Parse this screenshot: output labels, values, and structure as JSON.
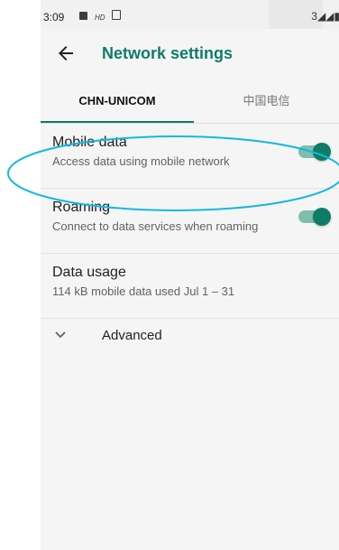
{
  "status_bar": {
    "time": "3:09",
    "signal_text": "3◢◢▮"
  },
  "toolbar": {
    "back_icon": "arrow-back-icon",
    "title": "Network settings"
  },
  "tabs": [
    {
      "label": "CHN-UNICOM",
      "selected": true
    },
    {
      "label": "中国电信",
      "selected": false
    }
  ],
  "settings": {
    "mobile_data": {
      "title": "Mobile data",
      "subtitle": "Access data using mobile network",
      "enabled": true
    },
    "roaming": {
      "title": "Roaming",
      "subtitle": "Connect to data services when roaming",
      "enabled": true
    },
    "data_usage": {
      "title": "Data usage",
      "subtitle": "114 kB mobile data used Jul 1 – 31"
    },
    "advanced": {
      "label": "Advanced",
      "icon": "chevron-down-icon"
    }
  },
  "colors": {
    "accent": "#0f7c66",
    "switch_track": "#7fbeae",
    "annotation": "#12b8df"
  }
}
